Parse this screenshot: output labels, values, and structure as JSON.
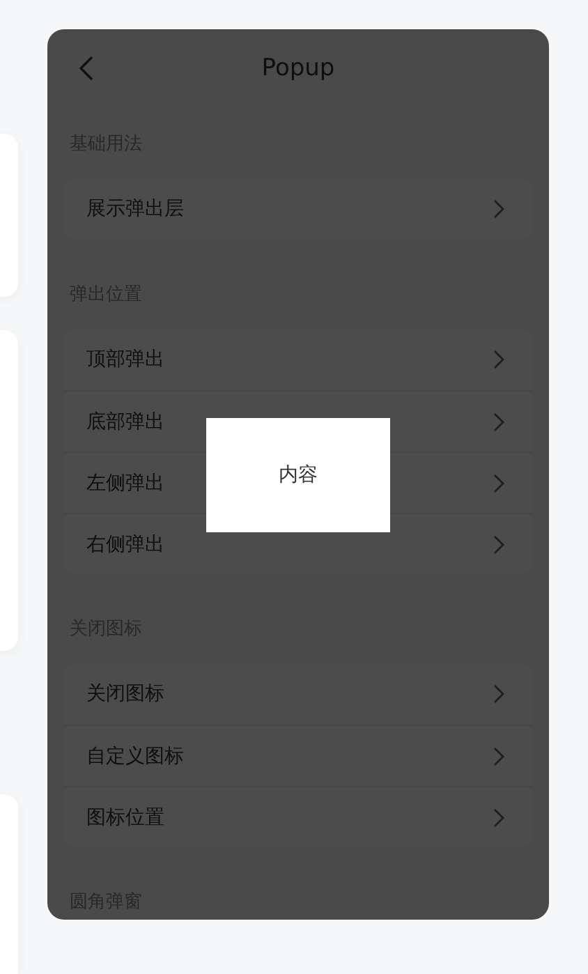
{
  "nav": {
    "title": "Popup"
  },
  "groups": [
    {
      "title": "基础用法",
      "items": [
        {
          "label": "展示弹出层"
        }
      ]
    },
    {
      "title": "弹出位置",
      "items": [
        {
          "label": "顶部弹出"
        },
        {
          "label": "底部弹出"
        },
        {
          "label": "左侧弹出"
        },
        {
          "label": "右侧弹出"
        }
      ]
    },
    {
      "title": "关闭图标",
      "items": [
        {
          "label": "关闭图标"
        },
        {
          "label": "自定义图标"
        },
        {
          "label": "图标位置"
        }
      ]
    },
    {
      "title": "圆角弹窗"
    }
  ],
  "overlay": {
    "visible": true
  },
  "popup": {
    "text": "内容"
  }
}
